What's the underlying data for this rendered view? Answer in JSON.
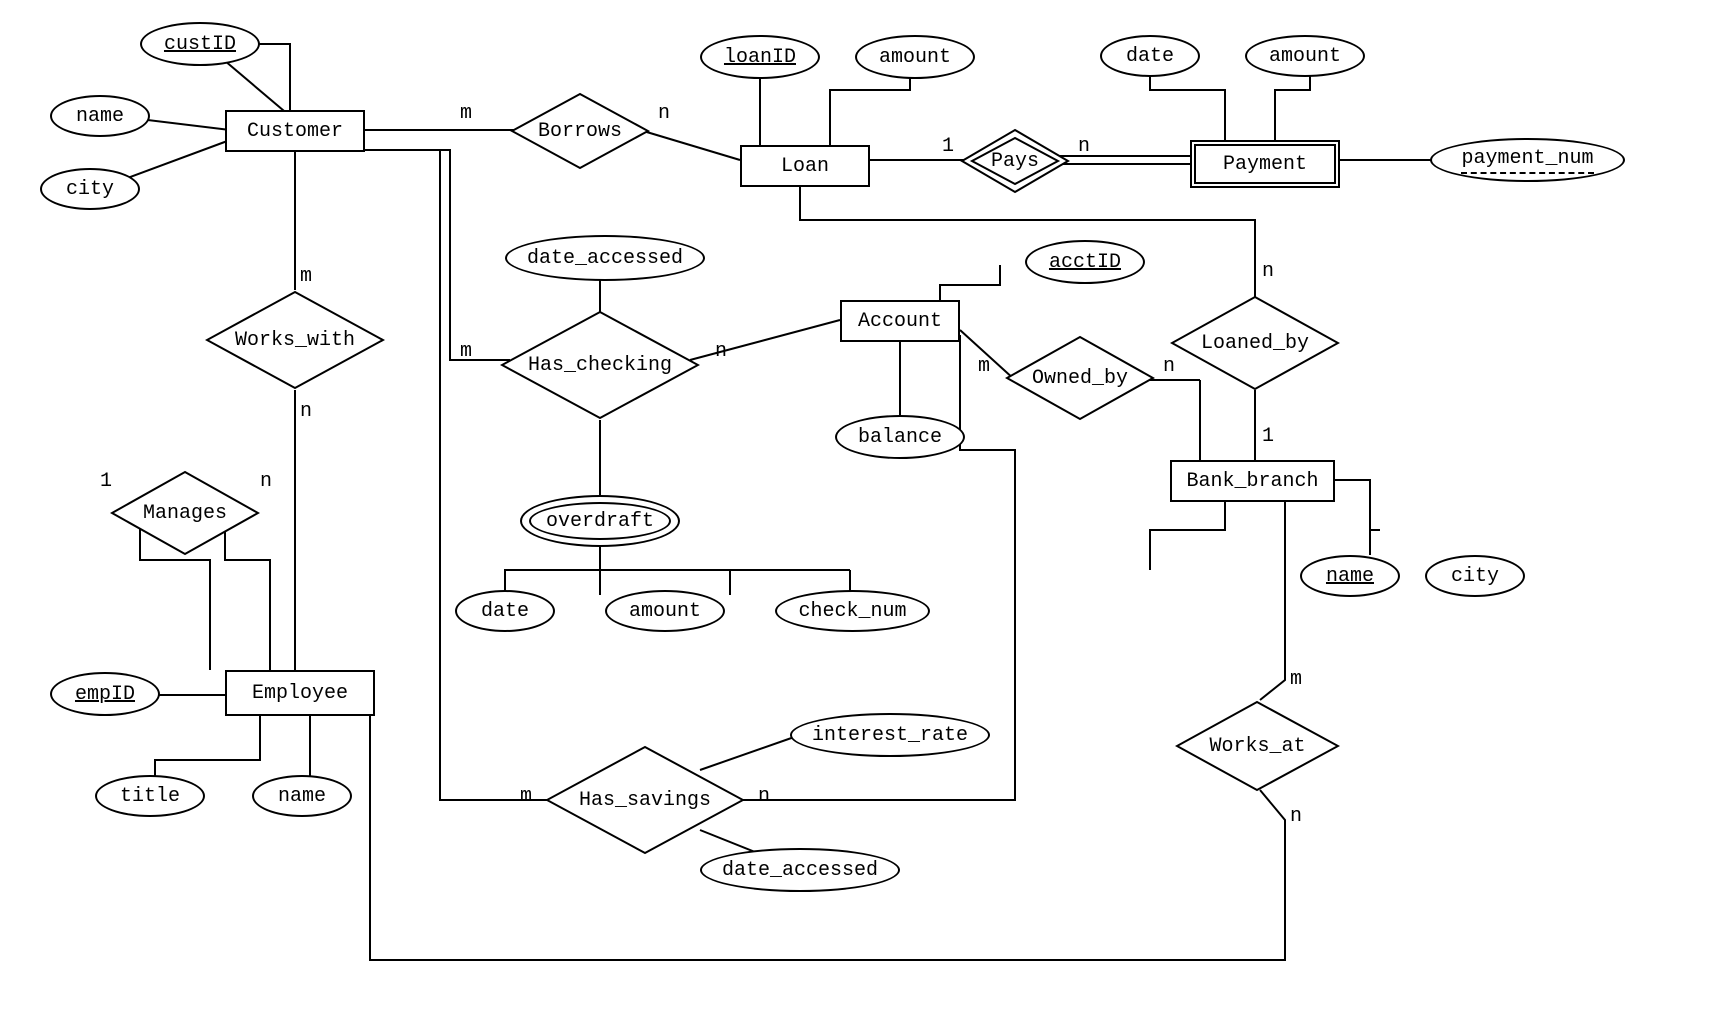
{
  "entities": {
    "customer": "Customer",
    "loan": "Loan",
    "payment": "Payment",
    "account": "Account",
    "bank_branch": "Bank_branch",
    "employee": "Employee"
  },
  "attributes": {
    "custID": "custID",
    "cust_name": "name",
    "cust_city": "city",
    "loanID": "loanID",
    "loan_amount": "amount",
    "pay_date": "date",
    "pay_amount": "amount",
    "payment_num": "payment_num",
    "acctID": "acctID",
    "balance": "balance",
    "date_accessed": "date_accessed",
    "overdraft": "overdraft",
    "od_date": "date",
    "od_amount": "amount",
    "od_check_num": "check_num",
    "interest_rate": "interest_rate",
    "sav_date_accessed": "date_accessed",
    "branch_name": "name",
    "branch_city": "city",
    "empID": "empID",
    "emp_title": "title",
    "emp_name": "name"
  },
  "relationships": {
    "borrows": "Borrows",
    "pays": "Pays",
    "works_with": "Works_with",
    "has_checking": "Has_checking",
    "owned_by": "Owned_by",
    "loaned_by": "Loaned_by",
    "manages": "Manages",
    "has_savings": "Has_savings",
    "works_at": "Works_at"
  },
  "cardinalities": {
    "borrows_cust": "m",
    "borrows_loan": "n",
    "pays_loan": "1",
    "pays_pay": "n",
    "works_with_cust": "m",
    "works_with_emp": "n",
    "has_checking_cust": "m",
    "has_checking_acct": "n",
    "owned_by_acct": "m",
    "owned_by_branch": "n",
    "loaned_by_loan": "n",
    "loaned_by_branch": "1",
    "manages_mgr": "1",
    "manages_emp": "n",
    "has_savings_cust": "m",
    "has_savings_acct": "n",
    "works_at_branch": "m",
    "works_at_emp": "n"
  }
}
